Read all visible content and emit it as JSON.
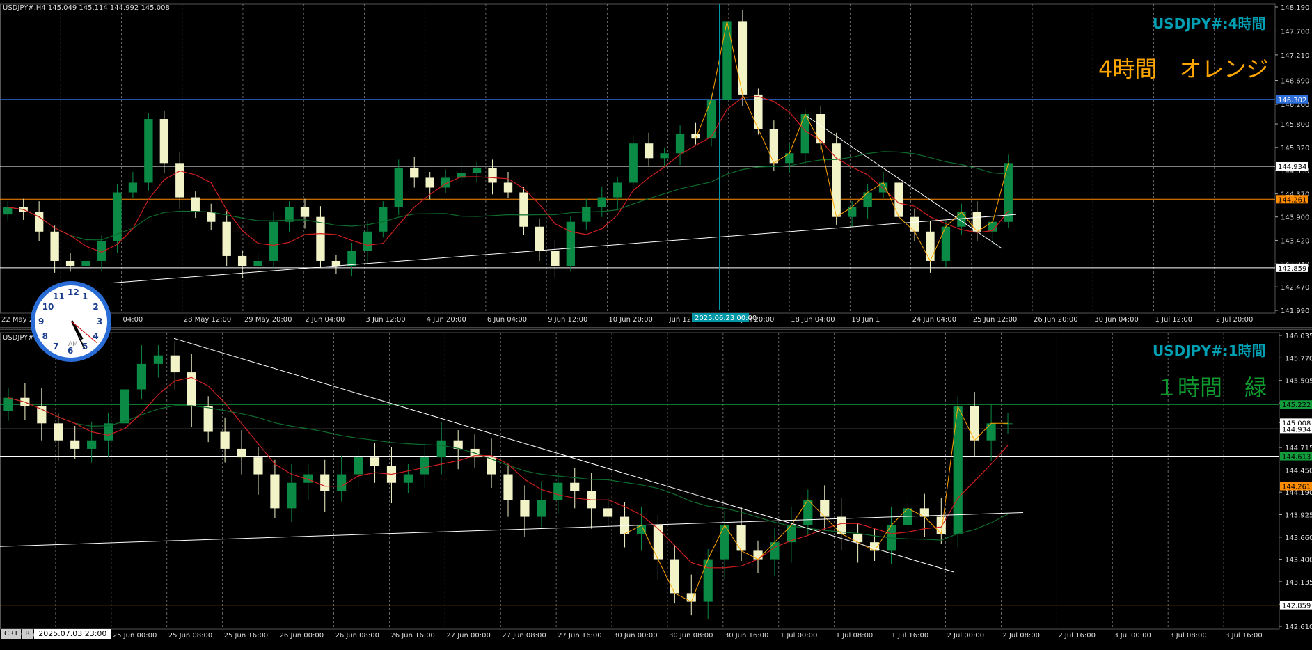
{
  "colors": {
    "bg": "#000000",
    "grid": "#7f7f7f",
    "bull": "#0a8a45",
    "bear": "#f3f3c8",
    "ma_fast": "#d11f1f",
    "ma_slow": "#0e6b2c",
    "zigzag": "#ffa500",
    "trend": "#ffffff",
    "hline_white": "#ffffff",
    "hline_orange": "#ff8c00",
    "hline_blue": "#2f6dd9",
    "hline_green": "#129c3b",
    "vline_cyan": "#0097a7",
    "title_cyan": "#00a0b4",
    "label_orange": "#ffa500",
    "label_green": "#0f9a2f"
  },
  "top_chart": {
    "info": "USDJPY#,H4  145.049 145.114 144.992 145.008",
    "title": "USDJPY#:4時間",
    "label": "4時間　オレンジ",
    "y_ticks": [
      "148.190",
      "147.700",
      "147.210",
      "146.690",
      "146.200",
      "145.800",
      "145.320",
      "144.850",
      "144.370",
      "143.900",
      "143.420",
      "142.940",
      "142.470",
      "141.990"
    ],
    "x_ticks": [
      "22 May 2",
      "",
      "04:00",
      "28 May 12:00",
      "29 May 20:00",
      "2 Jun 04:00",
      "3 Jun 12:00",
      "4 Jun 20:00",
      "6 Jun 04:00",
      "9 Jun 12:00",
      "10 Jun 20:00",
      "Jun 12:00",
      "16 Jun 20:00",
      "18 Jun 04:00",
      "19 Jun 1",
      "24 Jun 04:00",
      "25 Jun 12:00",
      "26 Jun 20:00",
      "30 Jun 04:00",
      "1 Jul 12:00",
      "2 Jul 20:00"
    ],
    "x_highlight": "2025.06.23 00:00",
    "price_tags": [
      {
        "text": "146.302",
        "bg": "#2f6dd9",
        "color": "#ffffff"
      },
      {
        "text": "144.934",
        "bg": "#ffffff",
        "color": "#000000"
      },
      {
        "text": "144.261",
        "bg": "#ff8c00",
        "color": "#000000"
      },
      {
        "text": "142.859",
        "bg": "#ffffff",
        "color": "#000000"
      }
    ]
  },
  "bottom_chart": {
    "info": "USDJPY#,H1  145.003 145.008",
    "title": "USDJPY#:1時間",
    "label": "１時間　緑",
    "y_ticks": [
      "146.035",
      "145.770",
      "145.505",
      "145.240",
      "145.008",
      "144.715",
      "144.450",
      "144.190",
      "143.925",
      "143.660",
      "143.400",
      "143.135",
      "142.870",
      "142.610"
    ],
    "x_ticks": [
      "24 Jun 2025",
      "24 Jun 16:00",
      "25 Jun 00:00",
      "25 Jun 08:00",
      "25 Jun 16:00",
      "26 Jun 00:00",
      "26 Jun 08:00",
      "26 Jun 16:00",
      "27 Jun 00:00",
      "27 Jun 08:00",
      "27 Jun 16:00",
      "30 Jun 00:00",
      "30 Jun 08:00",
      "30 Jun 16:00",
      "1 Jul 00:00",
      "1 Jul 08:00",
      "1 Jul 16:00",
      "2 Jul 00:00",
      "2 Jul 08:00",
      "2 Jul 16:00",
      "3 Jul 00:00",
      "3 Jul 08:00",
      "3 Jul 16:00"
    ],
    "price_tags": [
      {
        "text": "145.222",
        "bg": "#129c3b",
        "color": "#000000"
      },
      {
        "text": "145.008",
        "bg": "#ffffff",
        "color": "#000000"
      },
      {
        "text": "144.934",
        "bg": "#ffffff",
        "color": "#000000"
      },
      {
        "text": "144.613",
        "bg": "#129c3b",
        "color": "#000000"
      },
      {
        "text": "144.261",
        "bg": "#ff8c00",
        "color": "#000000"
      },
      {
        "text": "142.859",
        "bg": "#ffffff",
        "color": "#000000"
      }
    ]
  },
  "status": {
    "tab1": "CR1",
    "tab2": "R",
    "datetime": "2025.07.03 23:00"
  },
  "clock": {
    "numbers": [
      "12",
      "1",
      "2",
      "3",
      "4",
      "5",
      "6",
      "7",
      "8",
      "9",
      "10",
      "11"
    ],
    "ampm": "AM"
  },
  "chart_data": [
    {
      "type": "candlestick",
      "title": "USDJPY#:4時間",
      "symbol": "USDJPY#",
      "timeframe": "H4",
      "ylim": [
        141.99,
        148.19
      ],
      "last_ohlc": {
        "open": 145.049,
        "high": 145.114,
        "low": 144.992,
        "close": 145.008
      },
      "horizontal_levels": [
        146.302,
        144.934,
        144.261,
        142.859
      ],
      "series": [
        {
          "name": "close",
          "values": [
            144.1,
            144.0,
            143.6,
            143.0,
            142.9,
            143.0,
            143.4,
            144.4,
            144.6,
            145.9,
            145.0,
            144.3,
            144.0,
            143.8,
            143.1,
            142.9,
            143.0,
            143.8,
            144.1,
            143.9,
            143.0,
            142.9,
            143.2,
            143.6,
            144.1,
            144.9,
            144.7,
            144.5,
            144.7,
            144.8,
            144.9,
            144.6,
            144.4,
            143.7,
            143.2,
            142.9,
            143.8,
            144.1,
            144.3,
            144.6,
            145.4,
            145.1,
            145.2,
            145.6,
            145.5,
            146.3,
            147.9,
            146.4,
            145.7,
            145.0,
            145.2,
            146.0,
            145.4,
            143.9,
            144.1,
            144.4,
            144.6,
            143.9,
            143.6,
            143.0,
            143.7,
            144.0,
            143.6,
            143.8,
            145.0
          ]
        }
      ]
    },
    {
      "type": "candlestick",
      "title": "USDJPY#:1時間",
      "symbol": "USDJPY#",
      "timeframe": "H1",
      "ylim": [
        142.61,
        146.035
      ],
      "horizontal_levels": [
        145.222,
        144.934,
        144.613,
        144.261,
        142.859
      ],
      "series": [
        {
          "name": "close",
          "values": [
            145.3,
            145.2,
            145.0,
            144.8,
            144.7,
            144.8,
            145.0,
            145.4,
            145.7,
            145.8,
            145.6,
            145.2,
            144.9,
            144.7,
            144.6,
            144.4,
            144.0,
            144.3,
            144.4,
            144.2,
            144.4,
            144.6,
            144.5,
            144.3,
            144.4,
            144.6,
            144.8,
            144.7,
            144.6,
            144.4,
            144.1,
            143.9,
            144.1,
            144.3,
            144.2,
            144.0,
            143.9,
            143.7,
            143.8,
            143.4,
            143.0,
            142.9,
            143.4,
            143.8,
            143.5,
            143.4,
            143.6,
            143.8,
            144.1,
            143.9,
            143.7,
            143.6,
            143.5,
            143.8,
            144.0,
            143.9,
            143.7,
            145.2,
            144.8,
            145.0,
            145.0
          ]
        }
      ]
    }
  ]
}
